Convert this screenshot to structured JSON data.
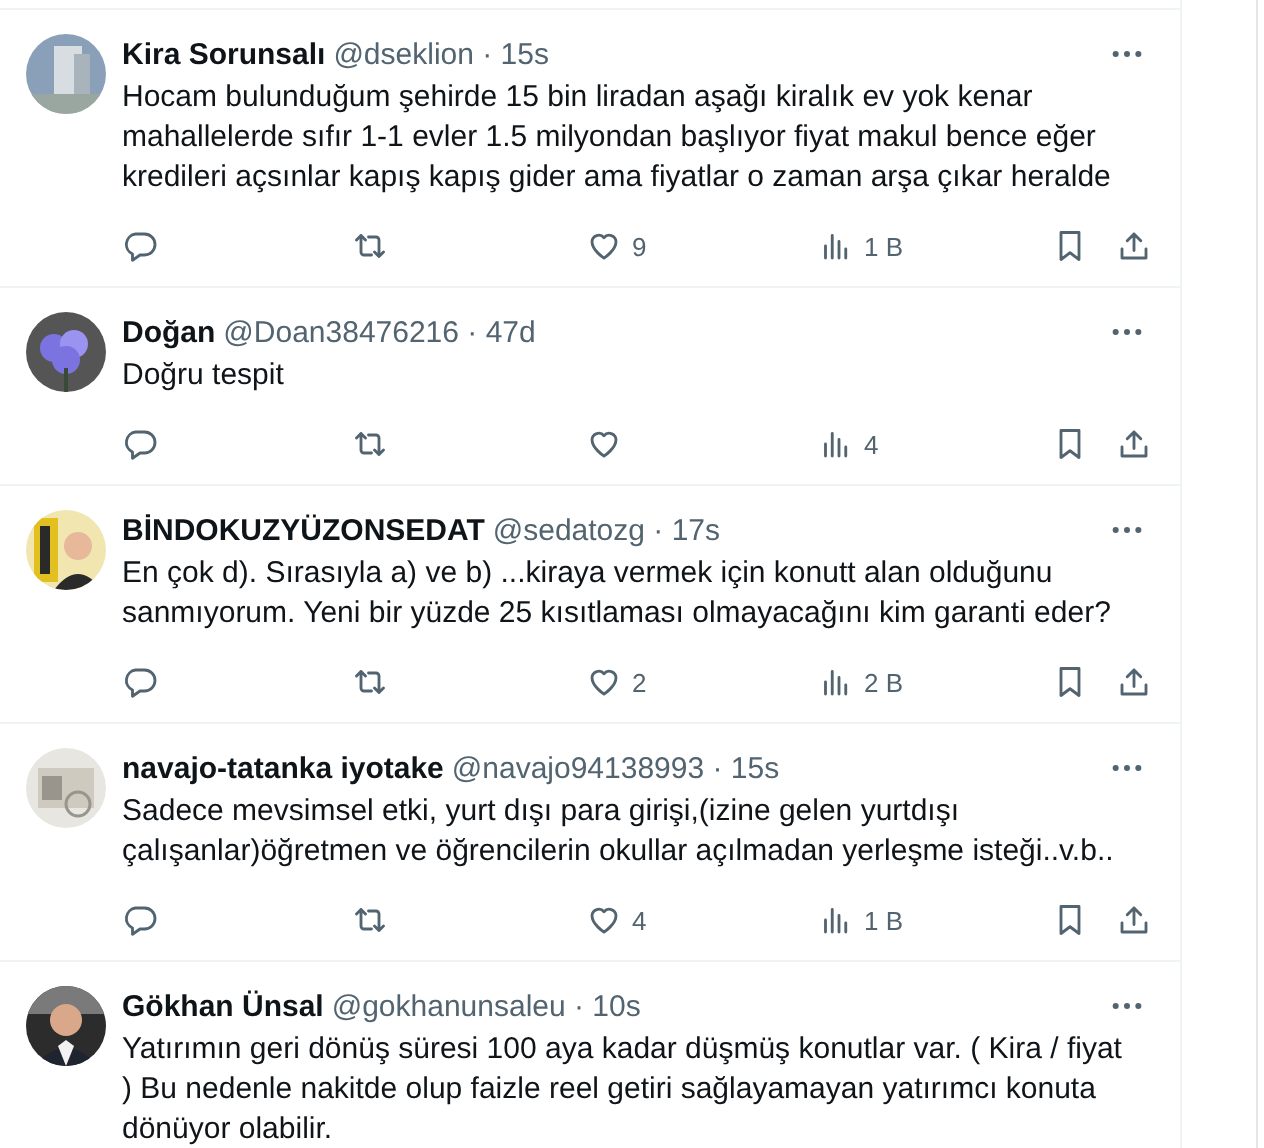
{
  "tweets": [
    {
      "name": "Kira Sorunsalı",
      "meta": "@dseklion · 15s",
      "text": "Hocam bulunduğum şehirde 15 bin liradan aşağı kiralık ev yok kenar mahallelerde sıfır 1-1 evler 1.5 milyondan başlıyor fiyat makul bence eğer kredileri açsınlar kapış kapış gider ama fiyatlar o zaman arşa çıkar heralde",
      "likes": "9",
      "views": "1 B"
    },
    {
      "name": "Doğan",
      "meta": "@Doan38476216 · 47d",
      "text": "Doğru tespit",
      "views": "4"
    },
    {
      "name": "BİNDOKUZYÜZONSEDAT",
      "meta": "@sedatozg · 17s",
      "text": "En çok d). Sırasıyla a) ve b) ...kiraya vermek için konutt alan olduğunu sanmıyorum. Yeni bir yüzde 25 kısıtlaması olmayacağını kim garanti eder?",
      "likes": "2",
      "views": "2 B"
    },
    {
      "name": "navajo-tatanka iyotake",
      "meta": "@navajo94138993 · 15s",
      "text": "Sadece mevsimsel etki, yurt dışı para girişi,(izine gelen yurtdışı çalışanlar)öğretmen ve öğrencilerin okullar açılmadan yerleşme isteği..v.b..",
      "likes": "4",
      "views": "1 B"
    },
    {
      "name": "Gökhan Ünsal",
      "meta": "@gokhanunsaleu · 10s",
      "text": "Yatırımın geri dönüş süresi 100 aya kadar düşmüş konutlar var. ( Kira / fiyat ) Bu nedenle nakitde olup faizle reel getiri sağlayamayan yatırımcı konuta dönüyor olabilir."
    }
  ]
}
